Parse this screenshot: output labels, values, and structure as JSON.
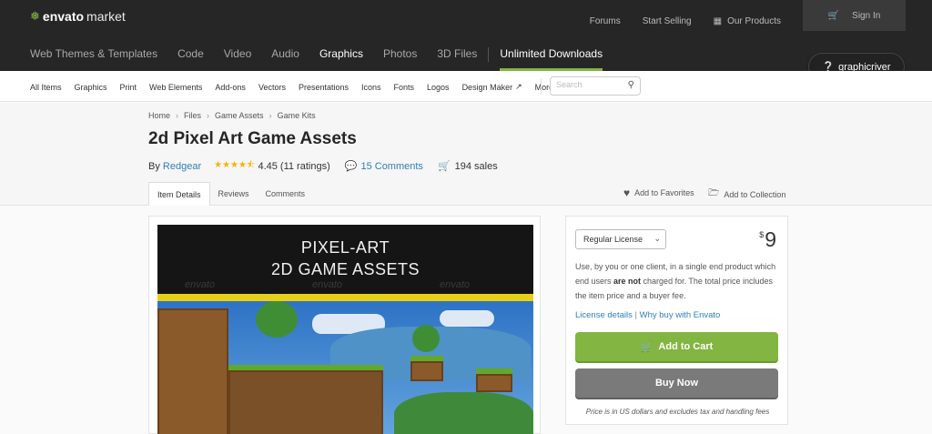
{
  "brand": {
    "name_bold": "envato",
    "name_rest": "market"
  },
  "top_links": {
    "forums": "Forums",
    "start_selling": "Start Selling",
    "our_products": "Our Products",
    "sign_in": "Sign In"
  },
  "main_nav": [
    "Web Themes & Templates",
    "Code",
    "Video",
    "Audio",
    "Graphics",
    "Photos",
    "3D Files",
    "Unlimited Downloads"
  ],
  "badge": "graphicriver",
  "sub_nav": [
    "All Items",
    "Graphics",
    "Print",
    "Web Elements",
    "Add-ons",
    "Vectors",
    "Presentations",
    "Icons",
    "Fonts",
    "Logos",
    "Design Maker",
    "More"
  ],
  "search": {
    "placeholder": "Search"
  },
  "breadcrumb": [
    "Home",
    "Files",
    "Game Assets",
    "Game Kits"
  ],
  "item": {
    "title": "2d Pixel Art Game Assets",
    "by": "By",
    "author": "Redgear",
    "stars": "★★★★⯪",
    "rating": "4.45 (11 ratings)",
    "comments": "15 Comments",
    "sales": "194 sales"
  },
  "tabs": [
    "Item Details",
    "Reviews",
    "Comments"
  ],
  "actions": {
    "favorites": "Add to Favorites",
    "collection": "Add to Collection"
  },
  "preview": {
    "line1": "PIXEL-ART",
    "line2": "2D GAME ASSETS",
    "watermark": "envato"
  },
  "purchase": {
    "license": "Regular License",
    "currency": "$",
    "price": "9",
    "desc_1": "Use, by you or one client, in a single end product which end users ",
    "desc_bold": "are not",
    "desc_2": " charged for. The total price includes the item price and a buyer fee.",
    "link_details": "License details",
    "link_sep": "|",
    "link_why": "Why buy with Envato",
    "add_to_cart": "Add to Cart",
    "buy_now": "Buy Now",
    "note": "Price is in US dollars and excludes tax and handling fees"
  },
  "colors": {
    "accent_green": "#82b541",
    "dark_bar": "#262626",
    "link_blue": "#2f7fb4",
    "star": "#f4b400"
  }
}
